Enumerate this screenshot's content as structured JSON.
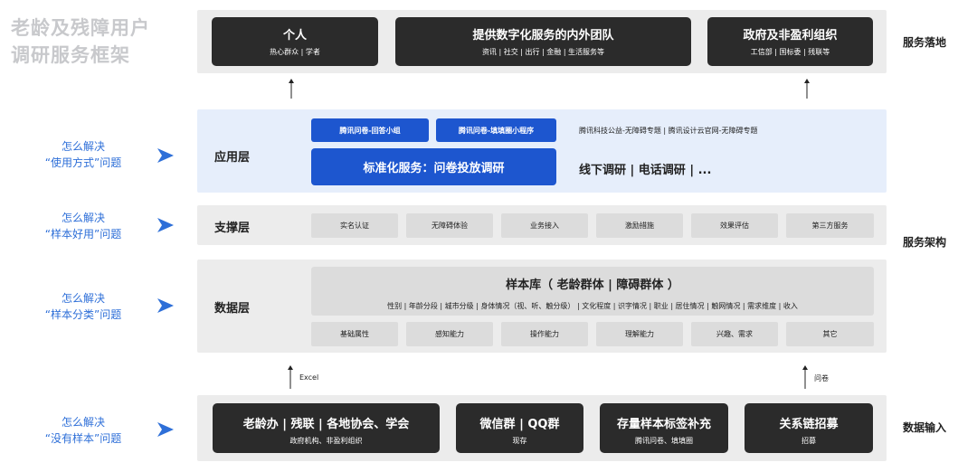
{
  "title": {
    "line1": "老龄及残障用户",
    "line2": "调研服务框架"
  },
  "service_layer": {
    "label": "服务落地",
    "boxes": [
      {
        "title": "个人",
        "sub": "热心群众 | 学者"
      },
      {
        "title": "提供数字化服务的内外团队",
        "sub": "资讯 | 社交 | 出行 | 金融 | 生活服务等"
      },
      {
        "title": "政府及非盈利组织",
        "sub": "工信部 | 国标委 | 残联等"
      }
    ]
  },
  "architecture_label": "服务架构",
  "app_layer": {
    "label": "应用层",
    "question": {
      "line1": "怎么解决",
      "line2": "“使用方式”问题"
    },
    "btn_small_1": "腾讯问卷-回答小组",
    "btn_small_2": "腾讯问卷-填填圈小程序",
    "top_text": "腾讯科技公益-无障碍专题 | 腾讯设计云官网-无障碍专题",
    "btn_main": "标准化服务：问卷投放调研",
    "main_text": "线下调研 | 电话调研 | ..."
  },
  "support_layer": {
    "label": "支撑层",
    "question": {
      "line1": "怎么解决",
      "line2": "“样本好用”问题"
    },
    "items": [
      "实名认证",
      "无障碍体验",
      "业务接入",
      "激励措施",
      "效果评估",
      "第三方服务"
    ]
  },
  "data_layer": {
    "label": "数据层",
    "question": {
      "line1": "怎么解决",
      "line2": "“样本分类”问题"
    },
    "sample_title": "样本库（ 老龄群体 | 障碍群体 ）",
    "sample_sub": "性别 | 年龄分段 | 城市分级 | 身体情况（视、听、触分级） | 文化程度 | 识字情况 | 职业 | 居住情况 | 触网情况 | 需求维度 | 收入",
    "items": [
      "基础属性",
      "感知能力",
      "操作能力",
      "理解能力",
      "兴趣、需求",
      "其它"
    ]
  },
  "arrows": {
    "left_label": "Excel",
    "right_label": "问卷"
  },
  "input_layer": {
    "label": "数据输入",
    "question": {
      "line1": "怎么解决",
      "line2": "“没有样本”问题"
    },
    "boxes": [
      {
        "title": "老龄办 | 残联 | 各地协会、学会",
        "sub": "政府机构、非盈利组织"
      },
      {
        "title": "微信群 | QQ群",
        "sub": "现存"
      },
      {
        "title": "存量样本标签补充",
        "sub": "腾讯问卷、填填圈"
      },
      {
        "title": "关系链招募",
        "sub": "招募"
      }
    ]
  },
  "colors": {
    "accent": "#2e6fd8",
    "dark": "#2b2b2b",
    "blue_button": "#1d56cf",
    "band": "#ececec",
    "app_band": "#e6eefb"
  }
}
